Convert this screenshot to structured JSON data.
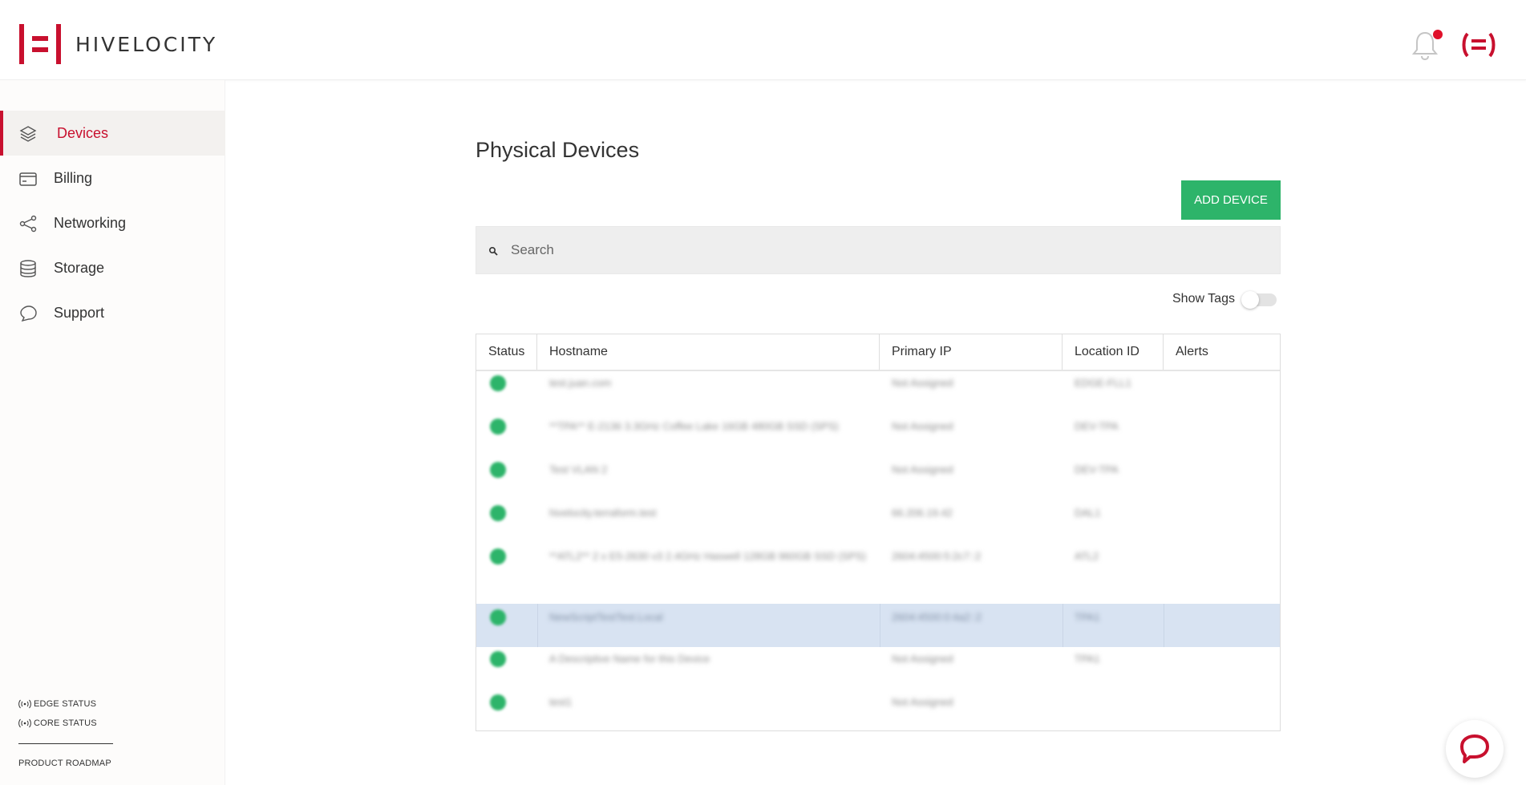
{
  "brand": {
    "name": "HIVELOCITY",
    "accent": "#c8102e",
    "success": "#2db46a"
  },
  "header": {
    "notification_dot": true
  },
  "sidebar": {
    "items": [
      {
        "label": "Devices",
        "icon": "layers-icon",
        "active": true
      },
      {
        "label": "Billing",
        "icon": "credit-card-icon",
        "active": false
      },
      {
        "label": "Networking",
        "icon": "share-icon",
        "active": false
      },
      {
        "label": "Storage",
        "icon": "database-icon",
        "active": false
      },
      {
        "label": "Support",
        "icon": "chat-bubble-icon",
        "active": false
      }
    ],
    "edge_status": "EDGE STATUS",
    "core_status": "CORE STATUS",
    "product_roadmap": "PRODUCT ROADMAP"
  },
  "main": {
    "title": "Physical Devices",
    "add_button": "ADD DEVICE",
    "search_placeholder": "Search",
    "show_tags": "Show Tags",
    "show_tags_on": false,
    "table": {
      "columns": [
        "Status",
        "Hostname",
        "Primary IP",
        "Location ID",
        "Alerts"
      ],
      "rows": [
        {
          "status": "online",
          "hostname": "test.juan.com",
          "ip": "Not Assigned",
          "location": "EDGE-FLL1",
          "alerts": "",
          "selected": false
        },
        {
          "status": "online",
          "hostname": "**TPA** E-2136 3.3GHz Coffee Lake 16GB 480GB SSD (SPS)",
          "ip": "Not Assigned",
          "location": "DEV-TPA",
          "alerts": "",
          "selected": false
        },
        {
          "status": "online",
          "hostname": "Test VLAN 2",
          "ip": "Not Assigned",
          "location": "DEV-TPA",
          "alerts": "",
          "selected": false
        },
        {
          "status": "online",
          "hostname": "hivelocity.terraform.test",
          "ip": "66.206.19.42",
          "location": "DAL1",
          "alerts": "",
          "selected": false
        },
        {
          "status": "online",
          "hostname": "**ATL2** 2 x E5-2630 v3 2.4GHz Haswell 128GB 960GB SSD (SPS)",
          "ip": "2604:4500:5:2c7::2",
          "location": "ATL2",
          "alerts": "",
          "selected": false
        },
        {
          "status": "online",
          "hostname": "NewScriptTestTest.Local",
          "ip": "2604:4500:0:4a2::2",
          "location": "TPA1",
          "alerts": "",
          "selected": true
        },
        {
          "status": "online",
          "hostname": "A Descriptive Name for this Device",
          "ip": "Not Assigned",
          "location": "TPA1",
          "alerts": "",
          "selected": false
        },
        {
          "status": "online",
          "hostname": "test1",
          "ip": "Not Assigned",
          "location": "",
          "alerts": "",
          "selected": false
        }
      ]
    }
  }
}
